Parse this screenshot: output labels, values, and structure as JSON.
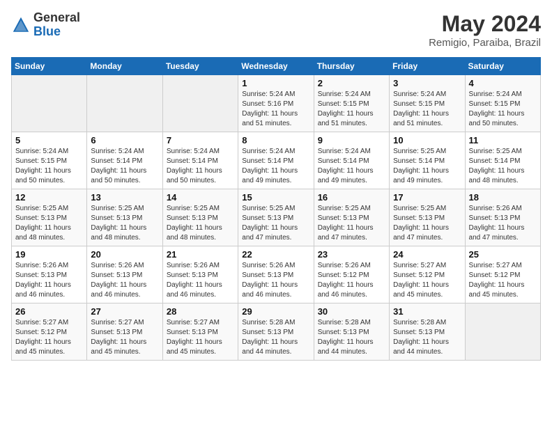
{
  "header": {
    "logo_general": "General",
    "logo_blue": "Blue",
    "month": "May 2024",
    "location": "Remigio, Paraiba, Brazil"
  },
  "days_of_week": [
    "Sunday",
    "Monday",
    "Tuesday",
    "Wednesday",
    "Thursday",
    "Friday",
    "Saturday"
  ],
  "weeks": [
    [
      {
        "day": "",
        "empty": true
      },
      {
        "day": "",
        "empty": true
      },
      {
        "day": "",
        "empty": true
      },
      {
        "day": "1",
        "sunrise": "5:24 AM",
        "sunset": "5:16 PM",
        "daylight": "11 hours and 51 minutes."
      },
      {
        "day": "2",
        "sunrise": "5:24 AM",
        "sunset": "5:15 PM",
        "daylight": "11 hours and 51 minutes."
      },
      {
        "day": "3",
        "sunrise": "5:24 AM",
        "sunset": "5:15 PM",
        "daylight": "11 hours and 51 minutes."
      },
      {
        "day": "4",
        "sunrise": "5:24 AM",
        "sunset": "5:15 PM",
        "daylight": "11 hours and 50 minutes."
      }
    ],
    [
      {
        "day": "5",
        "sunrise": "5:24 AM",
        "sunset": "5:15 PM",
        "daylight": "11 hours and 50 minutes."
      },
      {
        "day": "6",
        "sunrise": "5:24 AM",
        "sunset": "5:14 PM",
        "daylight": "11 hours and 50 minutes."
      },
      {
        "day": "7",
        "sunrise": "5:24 AM",
        "sunset": "5:14 PM",
        "daylight": "11 hours and 50 minutes."
      },
      {
        "day": "8",
        "sunrise": "5:24 AM",
        "sunset": "5:14 PM",
        "daylight": "11 hours and 49 minutes."
      },
      {
        "day": "9",
        "sunrise": "5:24 AM",
        "sunset": "5:14 PM",
        "daylight": "11 hours and 49 minutes."
      },
      {
        "day": "10",
        "sunrise": "5:25 AM",
        "sunset": "5:14 PM",
        "daylight": "11 hours and 49 minutes."
      },
      {
        "day": "11",
        "sunrise": "5:25 AM",
        "sunset": "5:14 PM",
        "daylight": "11 hours and 48 minutes."
      }
    ],
    [
      {
        "day": "12",
        "sunrise": "5:25 AM",
        "sunset": "5:13 PM",
        "daylight": "11 hours and 48 minutes."
      },
      {
        "day": "13",
        "sunrise": "5:25 AM",
        "sunset": "5:13 PM",
        "daylight": "11 hours and 48 minutes."
      },
      {
        "day": "14",
        "sunrise": "5:25 AM",
        "sunset": "5:13 PM",
        "daylight": "11 hours and 48 minutes."
      },
      {
        "day": "15",
        "sunrise": "5:25 AM",
        "sunset": "5:13 PM",
        "daylight": "11 hours and 47 minutes."
      },
      {
        "day": "16",
        "sunrise": "5:25 AM",
        "sunset": "5:13 PM",
        "daylight": "11 hours and 47 minutes."
      },
      {
        "day": "17",
        "sunrise": "5:25 AM",
        "sunset": "5:13 PM",
        "daylight": "11 hours and 47 minutes."
      },
      {
        "day": "18",
        "sunrise": "5:26 AM",
        "sunset": "5:13 PM",
        "daylight": "11 hours and 47 minutes."
      }
    ],
    [
      {
        "day": "19",
        "sunrise": "5:26 AM",
        "sunset": "5:13 PM",
        "daylight": "11 hours and 46 minutes."
      },
      {
        "day": "20",
        "sunrise": "5:26 AM",
        "sunset": "5:13 PM",
        "daylight": "11 hours and 46 minutes."
      },
      {
        "day": "21",
        "sunrise": "5:26 AM",
        "sunset": "5:13 PM",
        "daylight": "11 hours and 46 minutes."
      },
      {
        "day": "22",
        "sunrise": "5:26 AM",
        "sunset": "5:13 PM",
        "daylight": "11 hours and 46 minutes."
      },
      {
        "day": "23",
        "sunrise": "5:26 AM",
        "sunset": "5:12 PM",
        "daylight": "11 hours and 46 minutes."
      },
      {
        "day": "24",
        "sunrise": "5:27 AM",
        "sunset": "5:12 PM",
        "daylight": "11 hours and 45 minutes."
      },
      {
        "day": "25",
        "sunrise": "5:27 AM",
        "sunset": "5:12 PM",
        "daylight": "11 hours and 45 minutes."
      }
    ],
    [
      {
        "day": "26",
        "sunrise": "5:27 AM",
        "sunset": "5:12 PM",
        "daylight": "11 hours and 45 minutes."
      },
      {
        "day": "27",
        "sunrise": "5:27 AM",
        "sunset": "5:13 PM",
        "daylight": "11 hours and 45 minutes."
      },
      {
        "day": "28",
        "sunrise": "5:27 AM",
        "sunset": "5:13 PM",
        "daylight": "11 hours and 45 minutes."
      },
      {
        "day": "29",
        "sunrise": "5:28 AM",
        "sunset": "5:13 PM",
        "daylight": "11 hours and 44 minutes."
      },
      {
        "day": "30",
        "sunrise": "5:28 AM",
        "sunset": "5:13 PM",
        "daylight": "11 hours and 44 minutes."
      },
      {
        "day": "31",
        "sunrise": "5:28 AM",
        "sunset": "5:13 PM",
        "daylight": "11 hours and 44 minutes."
      },
      {
        "day": "",
        "empty": true
      }
    ]
  ]
}
